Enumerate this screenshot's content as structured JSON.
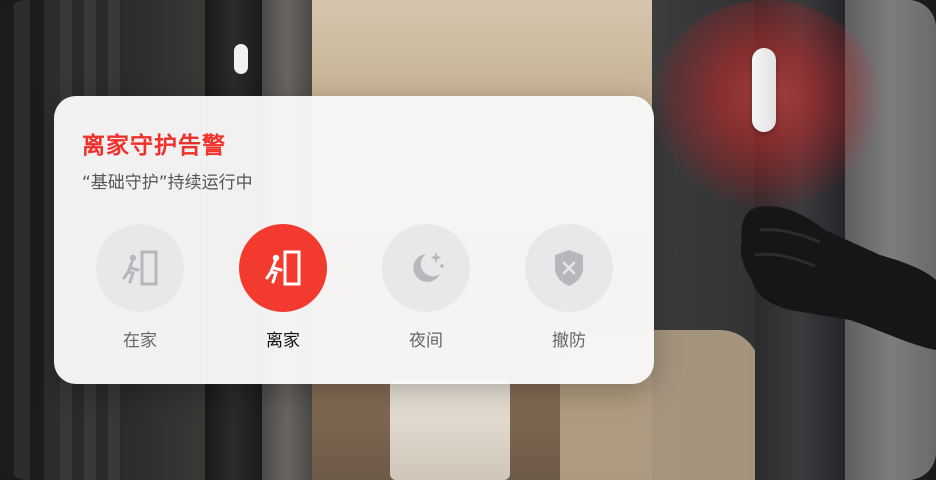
{
  "alert": {
    "title": "离家守护告警",
    "subtitle": "“基础守护”持续运行中"
  },
  "modes": [
    {
      "label": "在家",
      "icon": "exit-door-icon",
      "active": false
    },
    {
      "label": "离家",
      "icon": "exit-door-icon",
      "active": true
    },
    {
      "label": "夜间",
      "icon": "moon-stars-icon",
      "active": false
    },
    {
      "label": "撤防",
      "icon": "shield-x-icon",
      "active": false
    }
  ],
  "colors": {
    "accent": "#f23a2e",
    "title": "#f0302a",
    "inactive_circle": "#e8e8ea",
    "inactive_icon": "#b8b8bc"
  }
}
